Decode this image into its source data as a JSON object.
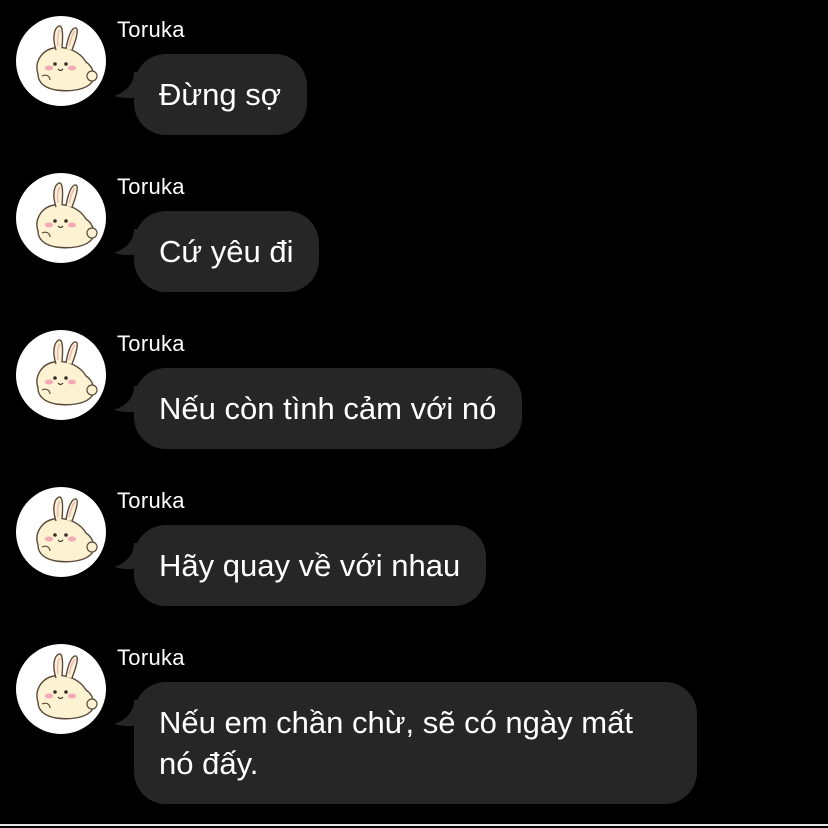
{
  "colors": {
    "background": "#000000",
    "bubble": "#262626",
    "text": "#ffffff",
    "avatar_bg": "#ffffff"
  },
  "messages": [
    {
      "sender": "Toruka",
      "avatar_icon": "bunny-avatar-icon",
      "text": "Đừng sợ"
    },
    {
      "sender": "Toruka",
      "avatar_icon": "bunny-avatar-icon",
      "text": "Cứ yêu đi"
    },
    {
      "sender": "Toruka",
      "avatar_icon": "bunny-avatar-icon",
      "text": "Nếu còn tình cảm với nó"
    },
    {
      "sender": "Toruka",
      "avatar_icon": "bunny-avatar-icon",
      "text": "Hãy quay về với nhau"
    },
    {
      "sender": "Toruka",
      "avatar_icon": "bunny-avatar-icon",
      "text": "Nếu em chần chừ, sẽ có ngày mất nó đấy."
    }
  ]
}
